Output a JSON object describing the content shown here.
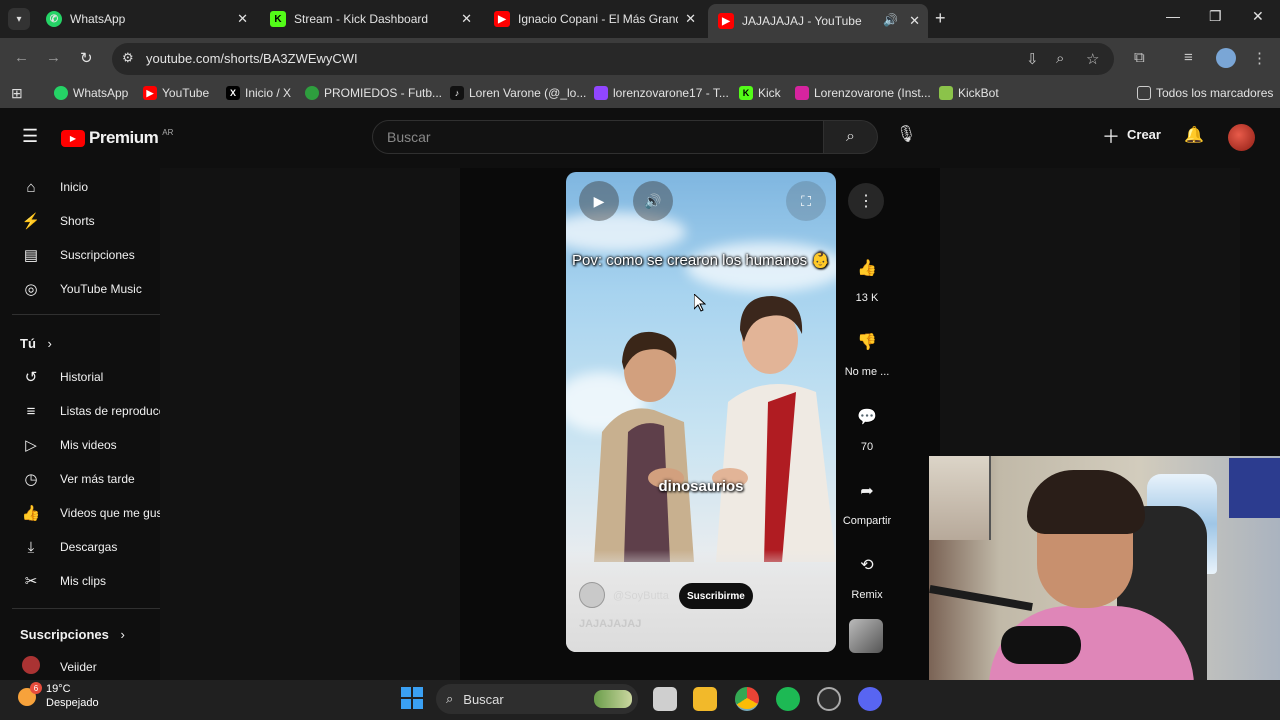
{
  "browser": {
    "tabs": [
      {
        "title": "WhatsApp",
        "favicon_color": "#25d366",
        "active": false
      },
      {
        "title": "Stream - Kick Dashboard",
        "favicon_color": "#53fc18",
        "active": false
      },
      {
        "title": "Ignacio Copani - El Más Grande",
        "favicon_color": "#ff0000",
        "active": false
      },
      {
        "title": "JAJAJAJAJ - YouTube",
        "favicon_color": "#ff0000",
        "active": true
      }
    ],
    "url": "youtube.com/shorts/BA3ZWEwyCWI",
    "bookmarks": [
      {
        "label": "WhatsApp",
        "color": "#25d366"
      },
      {
        "label": "YouTube",
        "color": "#ff0000"
      },
      {
        "label": "Inicio / X",
        "color": "#000000"
      },
      {
        "label": "PROMIEDOS - Futb...",
        "color": "#2e9e3e"
      },
      {
        "label": "Loren Varone (@_lo...",
        "color": "#111111"
      },
      {
        "label": "lorenzovarone17 - T...",
        "color": "#9146ff"
      },
      {
        "label": "Kick",
        "color": "#53fc18"
      },
      {
        "label": "Lorenzovarone (Inst...",
        "color": "#d6249f"
      },
      {
        "label": "KickBot",
        "color": "#8bc34a"
      }
    ],
    "all_bookmarks": "Todos los marcadores"
  },
  "youtube": {
    "logo_text": "Premium",
    "region": "AR",
    "search_placeholder": "Buscar",
    "create_label": "Crear",
    "sidebar": {
      "main": [
        {
          "label": "Inicio",
          "icon": "home-icon"
        },
        {
          "label": "Shorts",
          "icon": "shorts-icon"
        },
        {
          "label": "Suscripciones",
          "icon": "subscriptions-icon"
        },
        {
          "label": "YouTube Music",
          "icon": "music-icon"
        }
      ],
      "you_heading": "Tú",
      "you": [
        {
          "label": "Historial",
          "icon": "history-icon"
        },
        {
          "label": "Listas de reproducc...",
          "icon": "playlists-icon"
        },
        {
          "label": "Mis videos",
          "icon": "my-videos-icon"
        },
        {
          "label": "Ver más tarde",
          "icon": "watch-later-icon"
        },
        {
          "label": "Videos que me gus...",
          "icon": "liked-icon"
        },
        {
          "label": "Descargas",
          "icon": "downloads-icon"
        },
        {
          "label": "Mis clips",
          "icon": "clips-icon"
        }
      ],
      "subs_heading": "Suscripciones",
      "subs": [
        {
          "label": "Veiider",
          "icon": "channel-avatar"
        }
      ]
    },
    "short": {
      "caption_top": "Pov: como se crearon los humanos 👶",
      "caption_bottom": "dinosaurios",
      "channel": "@SoyButta",
      "subscribe": "Suscribirme",
      "title": "JAJAJAJAJ",
      "actions": [
        {
          "name": "like",
          "icon": "thumbs-up-icon",
          "label": "13 K"
        },
        {
          "name": "dislike",
          "icon": "thumbs-down-icon",
          "label": "No me ..."
        },
        {
          "name": "comments",
          "icon": "comment-icon",
          "label": "70"
        },
        {
          "name": "share",
          "icon": "share-icon",
          "label": "Compartir"
        },
        {
          "name": "remix",
          "icon": "remix-icon",
          "label": "Remix"
        }
      ]
    }
  },
  "taskbar": {
    "weather_temp": "19°C",
    "weather_desc": "Despejado",
    "weather_badge": "6",
    "search_label": "Buscar"
  }
}
